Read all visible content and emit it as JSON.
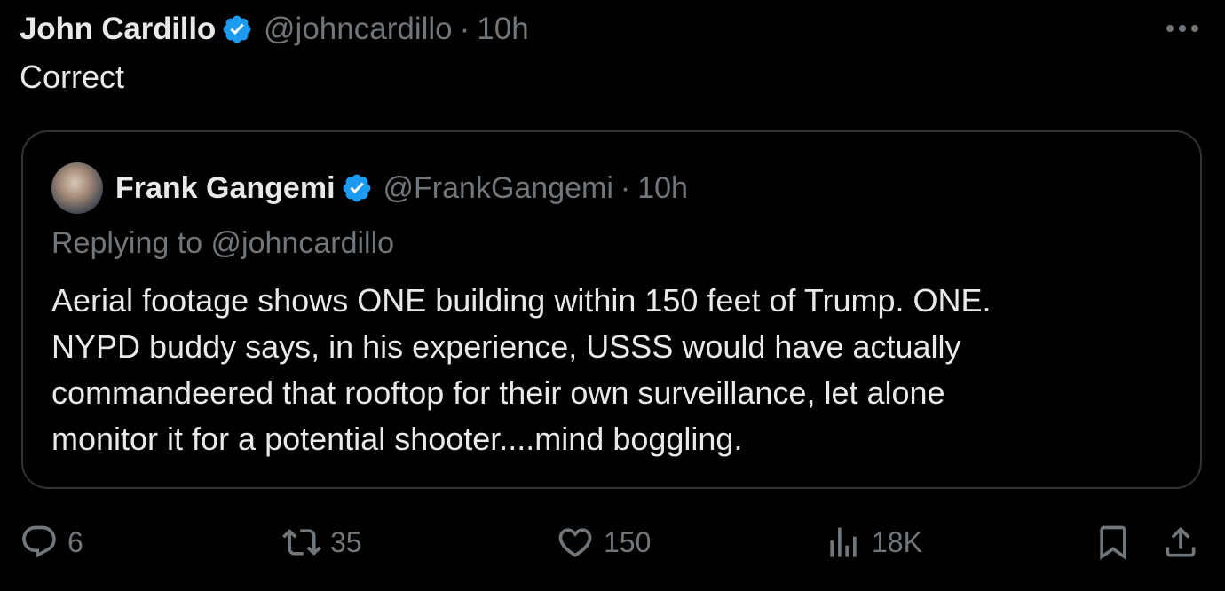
{
  "author": {
    "name": "John Cardillo",
    "handle": "@johncardillo",
    "separator": "·",
    "time": "10h"
  },
  "text": "Correct",
  "quote": {
    "name": "Frank Gangemi",
    "handle": "@FrankGangemi",
    "separator": "·",
    "time": "10h",
    "replying_to": "Replying to @johncardillo",
    "lines": [
      "Aerial footage shows ONE building within 150 feet of Trump. ONE.",
      "NYPD buddy says, in his experience, USSS would have actually",
      "commandeered that rooftop for their own surveillance, let alone",
      "monitor it for a potential shooter....mind boggling."
    ]
  },
  "actions": {
    "replies": "6",
    "retweets": "35",
    "likes": "150",
    "views": "18K"
  },
  "colors": {
    "background": "#000000",
    "text": "#e7e9ea",
    "secondary": "#71767b",
    "border": "#2f3336",
    "verified": "#1d9bf0"
  },
  "icons": [
    "verified-badge-icon",
    "more-icon",
    "reply-icon",
    "retweet-icon",
    "like-icon",
    "views-icon",
    "bookmark-icon",
    "share-icon"
  ]
}
